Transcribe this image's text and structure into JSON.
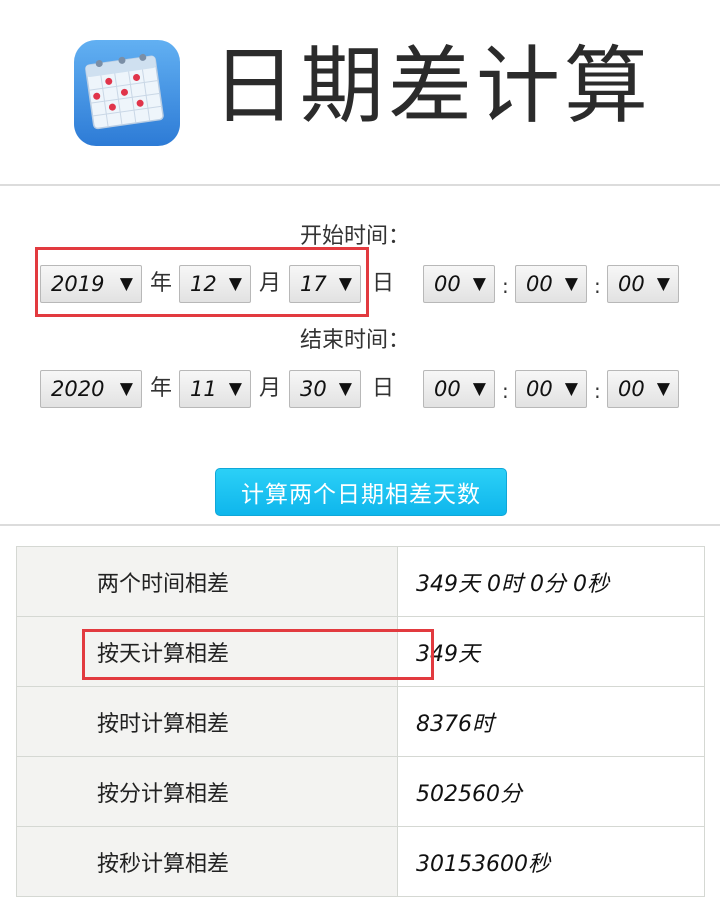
{
  "header": {
    "title": "日期差计算"
  },
  "start": {
    "label": "开始时间：",
    "year": "2019",
    "month": "12",
    "day": "17",
    "hour": "00",
    "minute": "00",
    "second": "00"
  },
  "end": {
    "label": "结束时间：",
    "year": "2020",
    "month": "11",
    "day": "30",
    "hour": "00",
    "minute": "00",
    "second": "00"
  },
  "units": {
    "year": "年",
    "month": "月",
    "day": "日",
    "colon": ":",
    "arrow": "▼"
  },
  "button": {
    "label": "计算两个日期相差天数"
  },
  "results": [
    {
      "label": "两个时间相差",
      "value": "349天 0时 0分 0秒"
    },
    {
      "label": "按天计算相差",
      "value": "349天"
    },
    {
      "label": "按时计算相差",
      "value": "8376时"
    },
    {
      "label": "按分计算相差",
      "value": "502560分"
    },
    {
      "label": "按秒计算相差",
      "value": "30153600秒"
    }
  ],
  "colors": {
    "accent": "#19c1f0",
    "highlight": "#e23a3f",
    "icon_bg": "#3f8fe0"
  },
  "icons": {
    "app": "calendar-icon"
  }
}
